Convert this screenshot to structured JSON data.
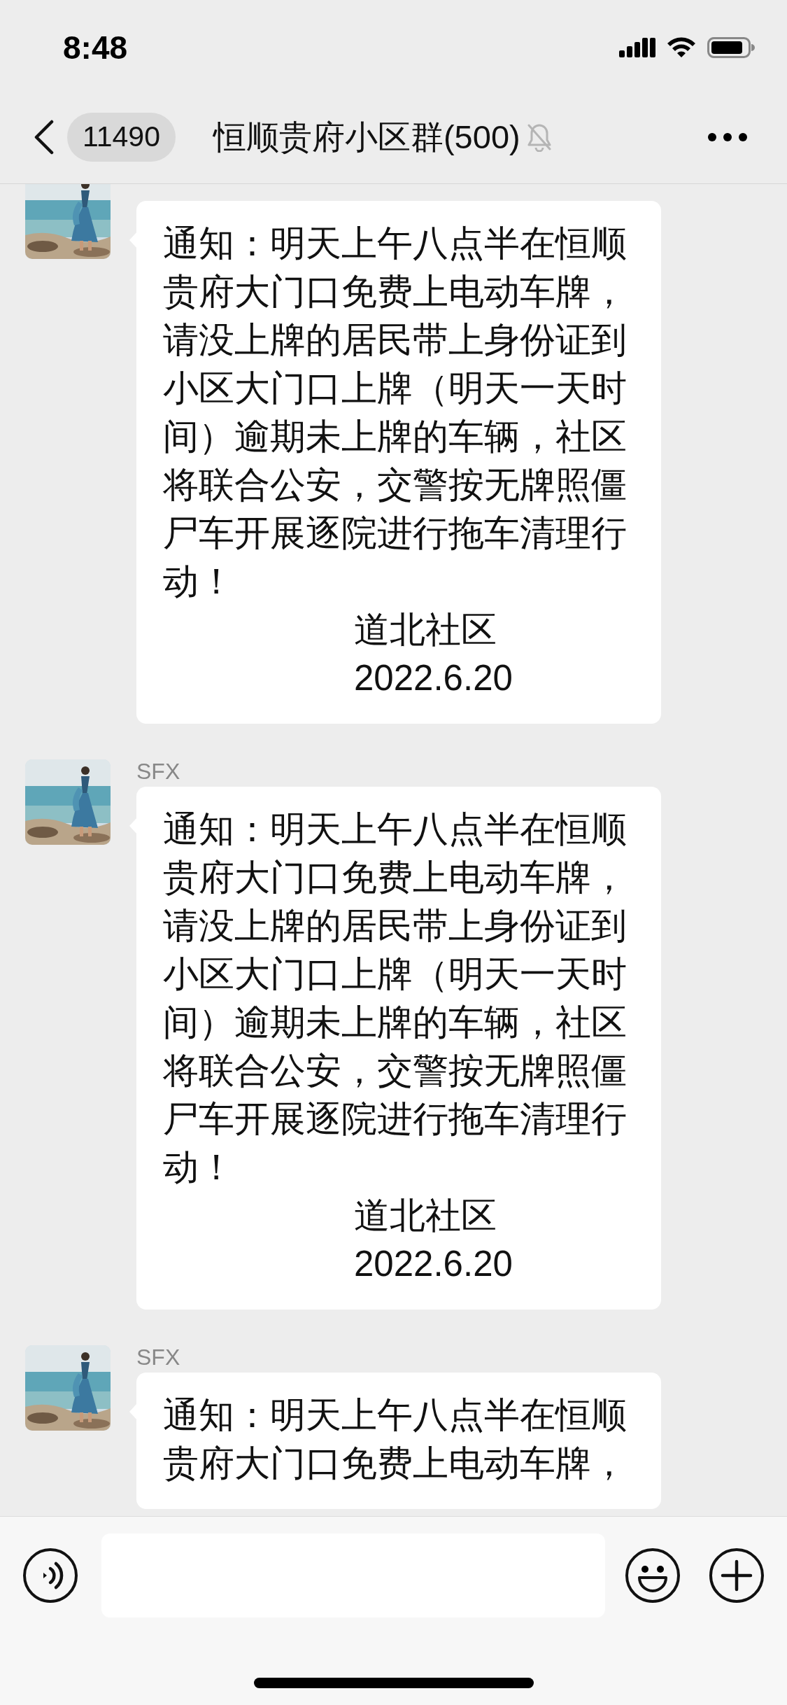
{
  "status_bar": {
    "time": "8:48"
  },
  "header": {
    "unread_count": "11490",
    "title": "恒顺贵府小区群(500)",
    "muted": true
  },
  "messages": [
    {
      "text": "通知：明天上午八点半在恒顺贵府大门口免费上电动车牌，请没上牌的居民带上身份证到小区大门口上牌（明天一天时间）逾期未上牌的车辆，社区将联合公安，交警按无牌照僵尸车开展逐院进行拖车清理行动！",
      "signature": [
        "道北社区",
        "2022.6.20"
      ]
    },
    {
      "sender": "SFX",
      "text": "通知：明天上午八点半在恒顺贵府大门口免费上电动车牌，请没上牌的居民带上身份证到小区大门口上牌（明天一天时间）逾期未上牌的车辆，社区将联合公安，交警按无牌照僵尸车开展逐院进行拖车清理行动！",
      "signature": [
        "道北社区",
        "2022.6.20"
      ]
    },
    {
      "sender": "SFX",
      "text": "通知：明天上午八点半在恒顺贵府大门口免费上电动车牌，"
    }
  ]
}
